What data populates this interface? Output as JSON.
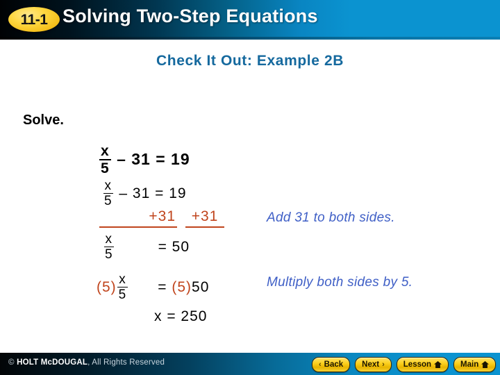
{
  "header": {
    "badge": "11-1",
    "title": "Solving Two-Step Equations",
    "accent_color": "#0b93d0",
    "badge_color": "#ffd740"
  },
  "subtitle": "Check It Out: Example 2B",
  "main": {
    "solve_label": "Solve.",
    "problem": {
      "numerator": "x",
      "denominator": "5",
      "rest": "– 31 = 19"
    },
    "work_line_1": {
      "numerator": "x",
      "denominator": "5",
      "rest": "– 31 = 19"
    },
    "add_step": {
      "left": "+31",
      "right": "+31",
      "color": "#c0441c"
    },
    "result_line": {
      "numerator": "x",
      "denominator": "5",
      "rest": "= 50"
    },
    "multiply_step": {
      "left_factor": "(5)",
      "numerator": "x",
      "denominator": "5",
      "equals": "=",
      "right_factor": "(5)",
      "right_value": "50"
    },
    "final_answer": "x = 250"
  },
  "annotations": {
    "add": "Add 31 to both sides.",
    "multiply": "Multiply both sides by 5.",
    "color": "#3f5fc6"
  },
  "footer": {
    "copyright_symbol": "© ",
    "brand": "HOLT McDOUGAL",
    "rights": ", All Rights Reserved",
    "nav": [
      {
        "label": "Back",
        "icon": "chevron-left-icon",
        "glyph": "‹"
      },
      {
        "label": "Next",
        "icon": "chevron-right-icon",
        "glyph": "›"
      },
      {
        "label": "Lesson",
        "icon": "home-icon",
        "glyph": ""
      },
      {
        "label": "Main",
        "icon": "home-icon",
        "glyph": ""
      }
    ]
  }
}
